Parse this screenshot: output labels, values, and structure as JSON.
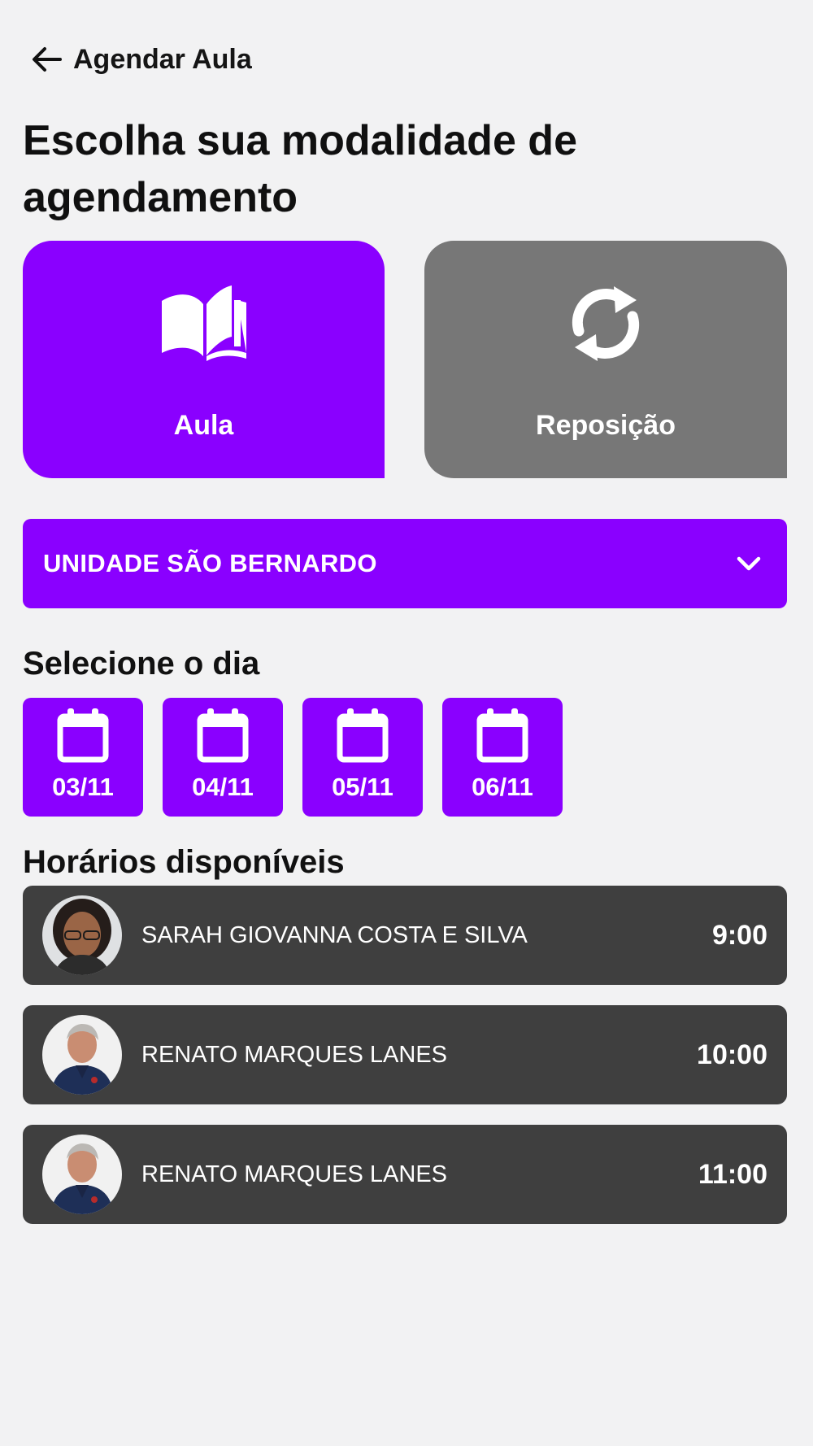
{
  "header": {
    "title": "Agendar Aula",
    "back_icon": "arrow-left-icon"
  },
  "page_title": "Escolha sua modalidade de agendamento",
  "modes": [
    {
      "label": "Aula",
      "icon": "open-book-icon",
      "selected": true
    },
    {
      "label": "Reposição",
      "icon": "refresh-icon",
      "selected": false
    }
  ],
  "unit_selector": {
    "value": "UNIDADE SÃO BERNARDO",
    "icon": "chevron-down-icon"
  },
  "days_section": {
    "title": "Selecione o dia",
    "days": [
      "03/11",
      "04/11",
      "05/11",
      "06/11"
    ]
  },
  "slots_section": {
    "title": "Horários disponíveis",
    "slots": [
      {
        "teacher": "SARAH GIOVANNA COSTA E SILVA",
        "time": "9:00",
        "avatar": "teacher-photo-avatar"
      },
      {
        "teacher": "RENATO MARQUES LANES",
        "time": "10:00",
        "avatar": "teacher-photo-avatar"
      },
      {
        "teacher": "RENATO MARQUES LANES",
        "time": "11:00",
        "avatar": "teacher-photo-avatar"
      }
    ]
  },
  "colors": {
    "accent": "#8a00ff",
    "inactive_card": "#777777",
    "slot_background": "#3f3f3f",
    "page_background": "#f2f2f3"
  }
}
